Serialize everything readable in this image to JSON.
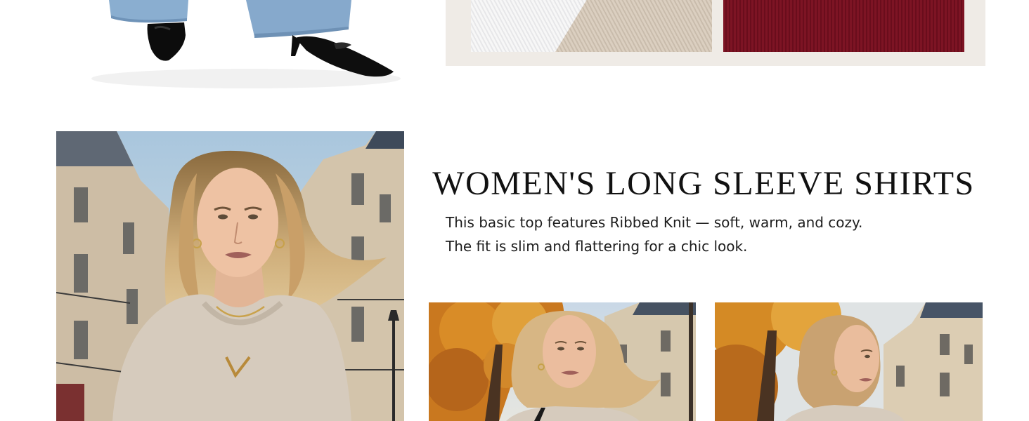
{
  "section": {
    "title": "WOMEN'S LONG SLEEVE SHIRTS",
    "description_lines": [
      "This basic top features Ribbed Knit — soft, warm, and cozy.",
      "The fit is slim and flattering for a chic look."
    ]
  },
  "images": {
    "shoes": "model-legs-jeans-black-heels-photo",
    "swatches": [
      "white-ribbed-knit",
      "beige-ribbed-knit",
      "burgundy-ribbed-knit"
    ],
    "main": "model-beige-v-neck-long-sleeve-portrait",
    "thumbnails": [
      "model-autumn-street-front",
      "model-autumn-street-back"
    ]
  },
  "colors": {
    "text": "#111111",
    "panel_bg": "#efebe6",
    "swatch_white": "#f1f1f2",
    "swatch_beige": "#d3c7b8",
    "swatch_burgundy": "#761222",
    "shirt_beige": "#d6cbbd"
  }
}
